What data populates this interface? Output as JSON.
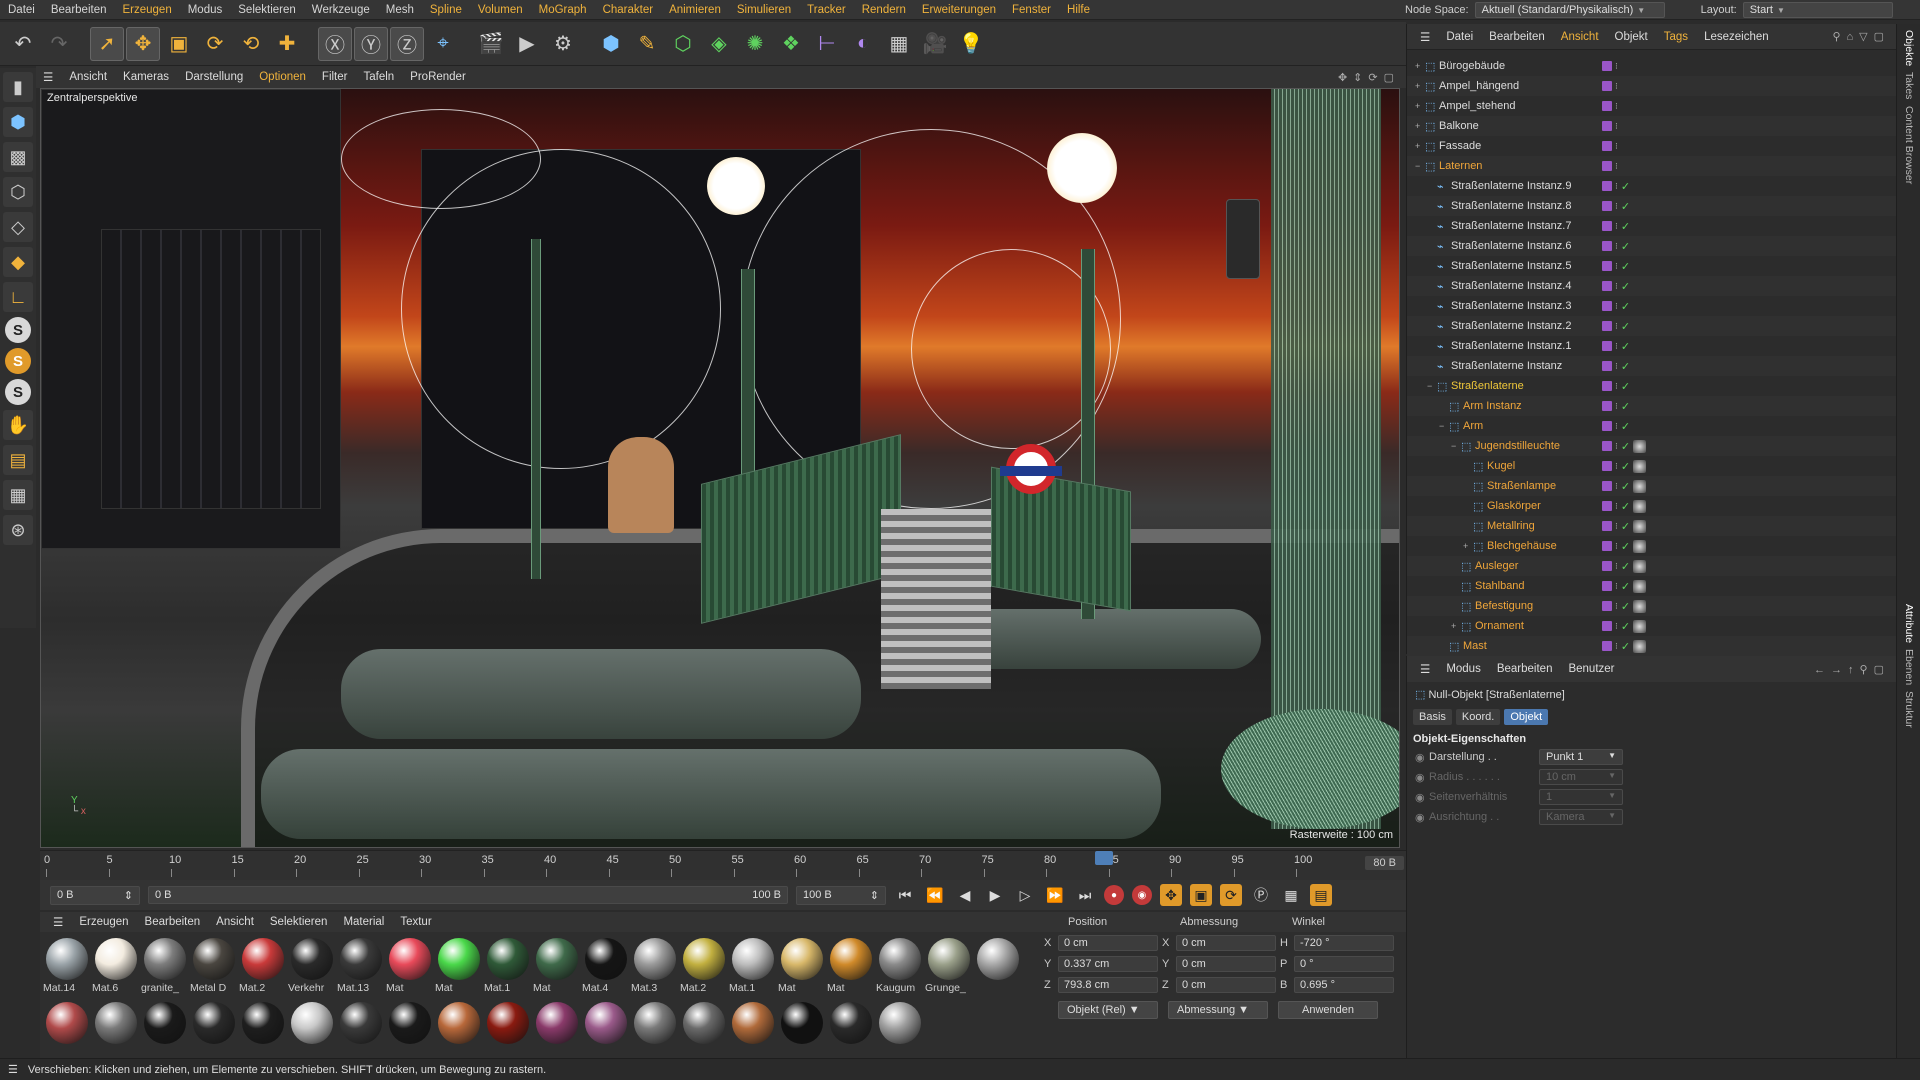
{
  "menubar": {
    "items": [
      "Datei",
      "Bearbeiten",
      "Erzeugen",
      "Modus",
      "Selektieren",
      "Werkzeuge",
      "Mesh",
      "Spline",
      "Volumen",
      "MoGraph",
      "Charakter",
      "Animieren",
      "Simulieren",
      "Tracker",
      "Rendern",
      "Erweiterungen",
      "Fenster",
      "Hilfe"
    ],
    "nodespace_label": "Node Space:",
    "nodespace_value": "Aktuell (Standard/Physikalisch)",
    "layout_label": "Layout:",
    "layout_value": "Start"
  },
  "viewport": {
    "menu": [
      "Ansicht",
      "Kameras",
      "Darstellung",
      "Optionen",
      "Filter",
      "Tafeln",
      "ProRender"
    ],
    "label": "Zentralperspektive",
    "scale": "Rasterweite : 100 cm"
  },
  "timeline": {
    "ticks": [
      "0",
      "5",
      "10",
      "15",
      "20",
      "25",
      "30",
      "35",
      "40",
      "45",
      "50",
      "55",
      "60",
      "65",
      "70",
      "75",
      "80",
      "85",
      "90",
      "95",
      "100"
    ],
    "current_frame": "80 B",
    "start": "0 B",
    "range_start": "0 B",
    "range_end": "100 B",
    "end": "100 B"
  },
  "materials": {
    "menu": [
      "Erzeugen",
      "Bearbeiten",
      "Ansicht",
      "Selektieren",
      "Material",
      "Textur"
    ],
    "row1": [
      {
        "name": "Mat.14",
        "color": "#9aa3a8"
      },
      {
        "name": "Mat.6",
        "color": "#f3ece0"
      },
      {
        "name": "granite_",
        "color": "#7d7d7d"
      },
      {
        "name": "Metal D",
        "color": "#4a4640"
      },
      {
        "name": "Mat.2",
        "color": "#c93a3a"
      },
      {
        "name": "Verkehr",
        "color": "#2a2a2a"
      },
      {
        "name": "Mat.13",
        "color": "#3a3a3a"
      },
      {
        "name": "Mat",
        "color": "#e84a5a"
      },
      {
        "name": "Mat",
        "color": "#4ad84a"
      },
      {
        "name": "Mat.1",
        "color": "#2f5a38"
      },
      {
        "name": "Mat",
        "color": "#3f6a4a"
      },
      {
        "name": "Mat.4",
        "color": "#151515"
      },
      {
        "name": "Mat.3",
        "color": "#9a9a9a"
      },
      {
        "name": "Mat.2",
        "color": "#c2b040"
      },
      {
        "name": "Mat.1",
        "color": "#bdbdbd"
      },
      {
        "name": "Mat",
        "color": "#d8b86a"
      },
      {
        "name": "Mat",
        "color": "#d08a2a"
      },
      {
        "name": "Kaugum",
        "color": "#8a8a8a"
      },
      {
        "name": "Grunge_",
        "color": "#9aa08a"
      }
    ],
    "row2": [
      {
        "color": "#a8a8a8"
      },
      {
        "color": "#b04a4a"
      },
      {
        "color": "#7a7a7a"
      },
      {
        "color": "#1a1a1a"
      },
      {
        "color": "#2a2a2a"
      },
      {
        "color": "#1e1e1e"
      },
      {
        "color": "#c8c8c8"
      },
      {
        "color": "#3a3a3a"
      },
      {
        "color": "#1a1a1a"
      },
      {
        "color": "#b8683a"
      },
      {
        "color": "#8a1a10"
      },
      {
        "color": "#8a3a6a"
      },
      {
        "color": "#9a5a8a"
      },
      {
        "color": "#7a7a7a"
      },
      {
        "color": "#6a6a6a"
      },
      {
        "color": "#b06a3a"
      },
      {
        "color": "#111111"
      },
      {
        "color": "#2a2a2a"
      },
      {
        "color": "#a0a0a0"
      }
    ]
  },
  "coords": {
    "headers": [
      "Position",
      "Abmessung",
      "Winkel"
    ],
    "rows": [
      {
        "a": "X",
        "av": "0 cm",
        "b": "X",
        "bv": "0 cm",
        "c": "H",
        "cv": "-720 °"
      },
      {
        "a": "Y",
        "av": "0.337 cm",
        "b": "Y",
        "bv": "0 cm",
        "c": "P",
        "cv": "0 °"
      },
      {
        "a": "Z",
        "av": "793.8 cm",
        "b": "Z",
        "bv": "0 cm",
        "c": "B",
        "cv": "0.695 °"
      }
    ],
    "mode": "Objekt (Rel)",
    "size_mode": "Abmessung",
    "apply": "Anwenden"
  },
  "status": "Verschieben: Klicken und ziehen, um Elemente zu verschieben. SHIFT drücken, um Bewegung zu rastern.",
  "objmgr": {
    "menu": [
      "Datei",
      "Bearbeiten",
      "Ansicht",
      "Objekt",
      "Tags",
      "Lesezeichen"
    ],
    "rows": [
      {
        "name": "Bürogebäude",
        "indent": 0,
        "exp": "+",
        "style": ""
      },
      {
        "name": "Ampel_hängend",
        "indent": 0,
        "exp": "+",
        "style": ""
      },
      {
        "name": "Ampel_stehend",
        "indent": 0,
        "exp": "+",
        "style": ""
      },
      {
        "name": "Balkone",
        "indent": 0,
        "exp": "+",
        "style": ""
      },
      {
        "name": "Fassade",
        "indent": 0,
        "exp": "+",
        "style": ""
      },
      {
        "name": "Laternen",
        "indent": 0,
        "exp": "−",
        "style": "orange"
      },
      {
        "name": "Straßenlaterne Instanz.9",
        "indent": 1,
        "exp": "",
        "style": ""
      },
      {
        "name": "Straßenlaterne Instanz.8",
        "indent": 1,
        "exp": "",
        "style": ""
      },
      {
        "name": "Straßenlaterne Instanz.7",
        "indent": 1,
        "exp": "",
        "style": ""
      },
      {
        "name": "Straßenlaterne Instanz.6",
        "indent": 1,
        "exp": "",
        "style": ""
      },
      {
        "name": "Straßenlaterne Instanz.5",
        "indent": 1,
        "exp": "",
        "style": ""
      },
      {
        "name": "Straßenlaterne Instanz.4",
        "indent": 1,
        "exp": "",
        "style": ""
      },
      {
        "name": "Straßenlaterne Instanz.3",
        "indent": 1,
        "exp": "",
        "style": ""
      },
      {
        "name": "Straßenlaterne Instanz.2",
        "indent": 1,
        "exp": "",
        "style": ""
      },
      {
        "name": "Straßenlaterne Instanz.1",
        "indent": 1,
        "exp": "",
        "style": ""
      },
      {
        "name": "Straßenlaterne Instanz",
        "indent": 1,
        "exp": "",
        "style": ""
      },
      {
        "name": "Straßenlaterne",
        "indent": 1,
        "exp": "−",
        "style": "yellow"
      },
      {
        "name": "Arm Instanz",
        "indent": 2,
        "exp": "",
        "style": "orange"
      },
      {
        "name": "Arm",
        "indent": 2,
        "exp": "−",
        "style": "orange"
      },
      {
        "name": "Jugendstilleuchte",
        "indent": 3,
        "exp": "−",
        "style": "orange"
      },
      {
        "name": "Kugel",
        "indent": 4,
        "exp": "",
        "style": "orange"
      },
      {
        "name": "Straßenlampe",
        "indent": 4,
        "exp": "",
        "style": "orange"
      },
      {
        "name": "Glaskörper",
        "indent": 4,
        "exp": "",
        "style": "orange"
      },
      {
        "name": "Metallring",
        "indent": 4,
        "exp": "",
        "style": "orange"
      },
      {
        "name": "Blechgehäuse",
        "indent": 4,
        "exp": "+",
        "style": "orange"
      },
      {
        "name": "Ausleger",
        "indent": 3,
        "exp": "",
        "style": "orange"
      },
      {
        "name": "Stahlband",
        "indent": 3,
        "exp": "",
        "style": "orange"
      },
      {
        "name": "Befestigung",
        "indent": 3,
        "exp": "",
        "style": "orange"
      },
      {
        "name": "Ornament",
        "indent": 3,
        "exp": "+",
        "style": "orange"
      },
      {
        "name": "Mast",
        "indent": 2,
        "exp": "",
        "style": "orange"
      }
    ]
  },
  "attr": {
    "menu": [
      "Modus",
      "Bearbeiten",
      "Benutzer"
    ],
    "title": "Null-Objekt [Straßenlaterne]",
    "tabs": [
      "Basis",
      "Koord.",
      "Objekt"
    ],
    "section": "Objekt-Eigenschaften",
    "props": [
      {
        "label": "Darstellung . .",
        "value": "Punkt 1",
        "dim": false
      },
      {
        "label": "Radius . . . . . .",
        "value": "10 cm",
        "dim": true
      },
      {
        "label": "Seitenverhältnis",
        "value": "1",
        "dim": true
      },
      {
        "label": "Ausrichtung . .",
        "value": "Kamera",
        "dim": true
      }
    ]
  },
  "rightstrip": [
    "Objekte",
    "Takes",
    "Content Browser",
    "Attribute",
    "Ebenen",
    "Struktur"
  ]
}
